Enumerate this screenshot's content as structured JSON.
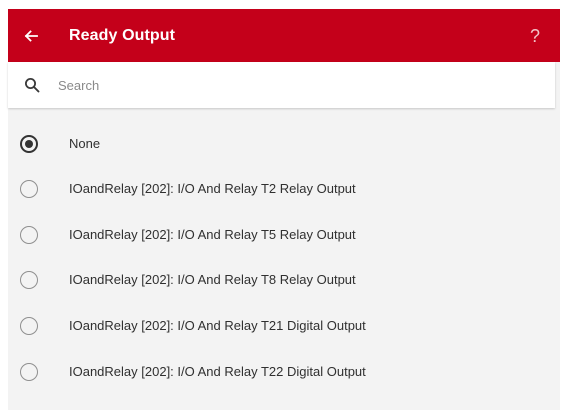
{
  "header": {
    "title": "Ready Output",
    "help_label": "?",
    "back_icon": "arrow-left-icon",
    "background": "#c4001a"
  },
  "search": {
    "placeholder": "Search",
    "value": "",
    "icon": "search-icon"
  },
  "options": [
    {
      "label": "None",
      "selected": true
    },
    {
      "label": "IOandRelay [202]: I/O And Relay T2 Relay Output",
      "selected": false
    },
    {
      "label": "IOandRelay [202]: I/O And Relay T5 Relay Output",
      "selected": false
    },
    {
      "label": "IOandRelay [202]: I/O And Relay T8 Relay Output",
      "selected": false
    },
    {
      "label": "IOandRelay [202]: I/O And Relay T21 Digital Output",
      "selected": false
    },
    {
      "label": "IOandRelay [202]: I/O And Relay T22 Digital Output",
      "selected": false
    }
  ]
}
